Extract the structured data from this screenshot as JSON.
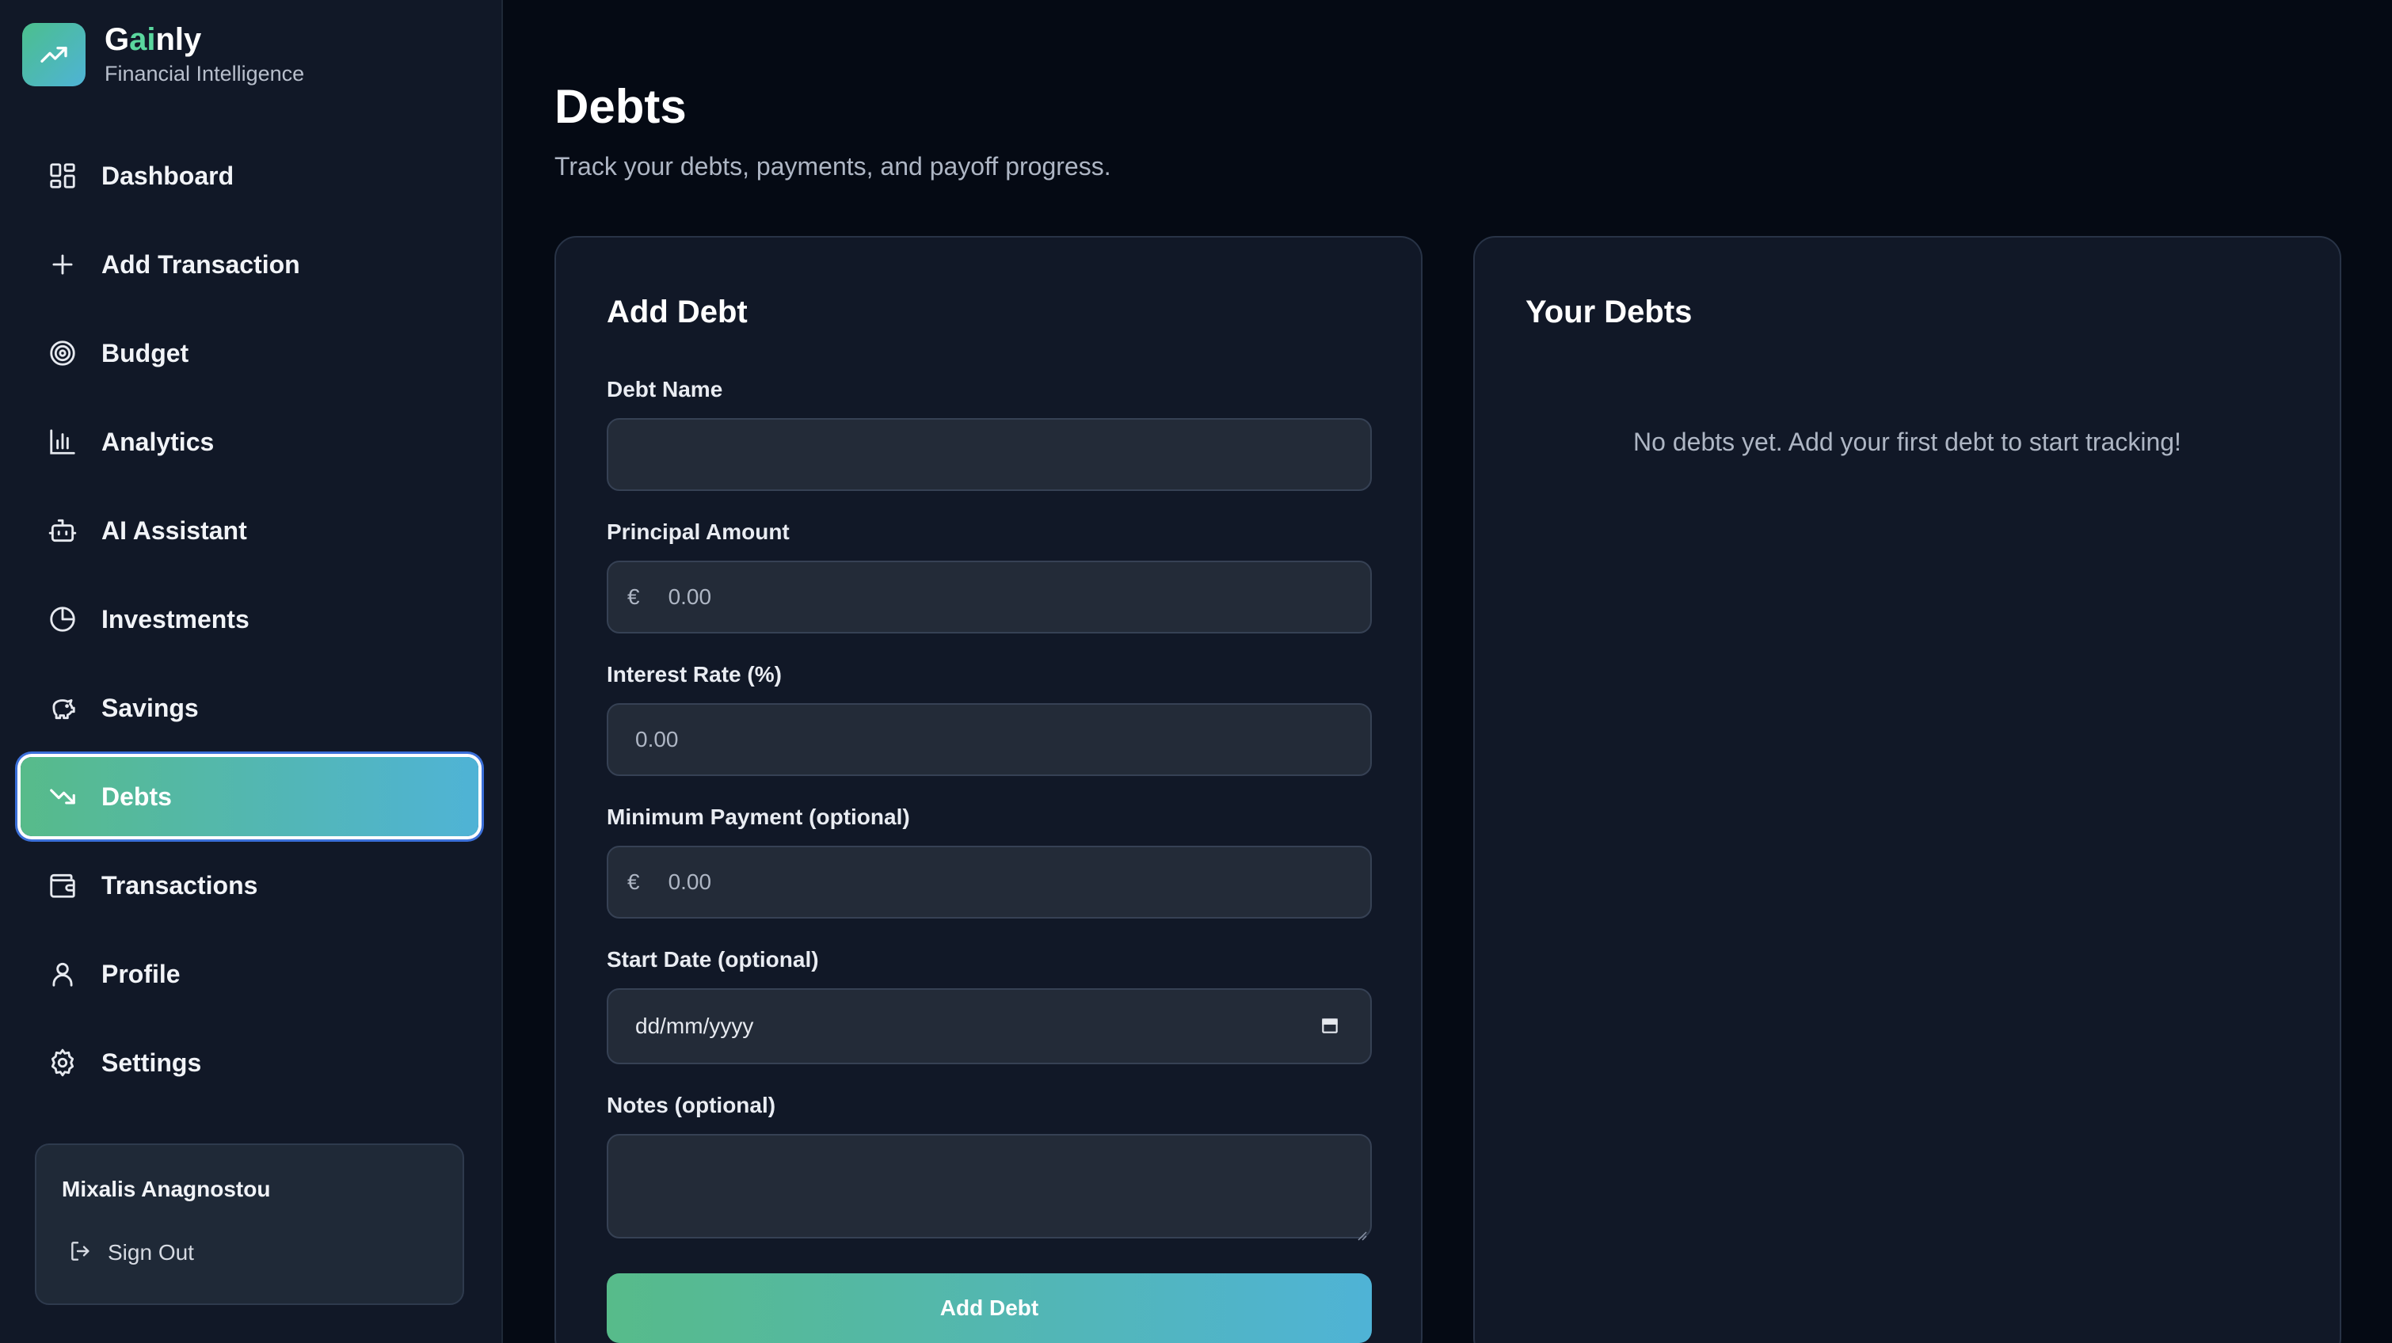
{
  "brand": {
    "name_start": "G",
    "name_accent": "ai",
    "name_end": "nly",
    "subtitle": "Financial Intelligence",
    "accent_color": "#5ad69e"
  },
  "sidebar": {
    "items": [
      {
        "label": "Dashboard",
        "icon": "layout-grid-icon"
      },
      {
        "label": "Add Transaction",
        "icon": "plus-icon"
      },
      {
        "label": "Budget",
        "icon": "target-icon"
      },
      {
        "label": "Analytics",
        "icon": "bar-chart-icon"
      },
      {
        "label": "AI Assistant",
        "icon": "bot-icon"
      },
      {
        "label": "Investments",
        "icon": "pie-chart-icon"
      },
      {
        "label": "Savings",
        "icon": "piggy-bank-icon"
      },
      {
        "label": "Debts",
        "icon": "trending-down-icon",
        "active": true
      },
      {
        "label": "Transactions",
        "icon": "wallet-icon"
      },
      {
        "label": "Profile",
        "icon": "user-icon"
      },
      {
        "label": "Settings",
        "icon": "gear-icon"
      }
    ],
    "active_gradient": [
      "#57bb8a",
      "#4fb3d6"
    ]
  },
  "user": {
    "name": "Mixalis Anagnostou",
    "sign_out_label": "Sign Out"
  },
  "page": {
    "title": "Debts",
    "subtitle": "Track your debts, payments, and payoff progress."
  },
  "form": {
    "title": "Add Debt",
    "debt_name": {
      "label": "Debt Name",
      "value": ""
    },
    "principal": {
      "label": "Principal Amount",
      "prefix": "€",
      "placeholder": "0.00"
    },
    "interest": {
      "label": "Interest Rate (%)",
      "placeholder": "0.00"
    },
    "min_payment": {
      "label": "Minimum Payment (optional)",
      "prefix": "€",
      "placeholder": "0.00"
    },
    "start_date": {
      "label": "Start Date (optional)",
      "placeholder": "dd/mm/yyyy"
    },
    "notes": {
      "label": "Notes (optional)",
      "value": ""
    },
    "submit_label": "Add Debt"
  },
  "debts_panel": {
    "title": "Your Debts",
    "empty_message": "No debts yet. Add your first debt to start tracking!"
  }
}
